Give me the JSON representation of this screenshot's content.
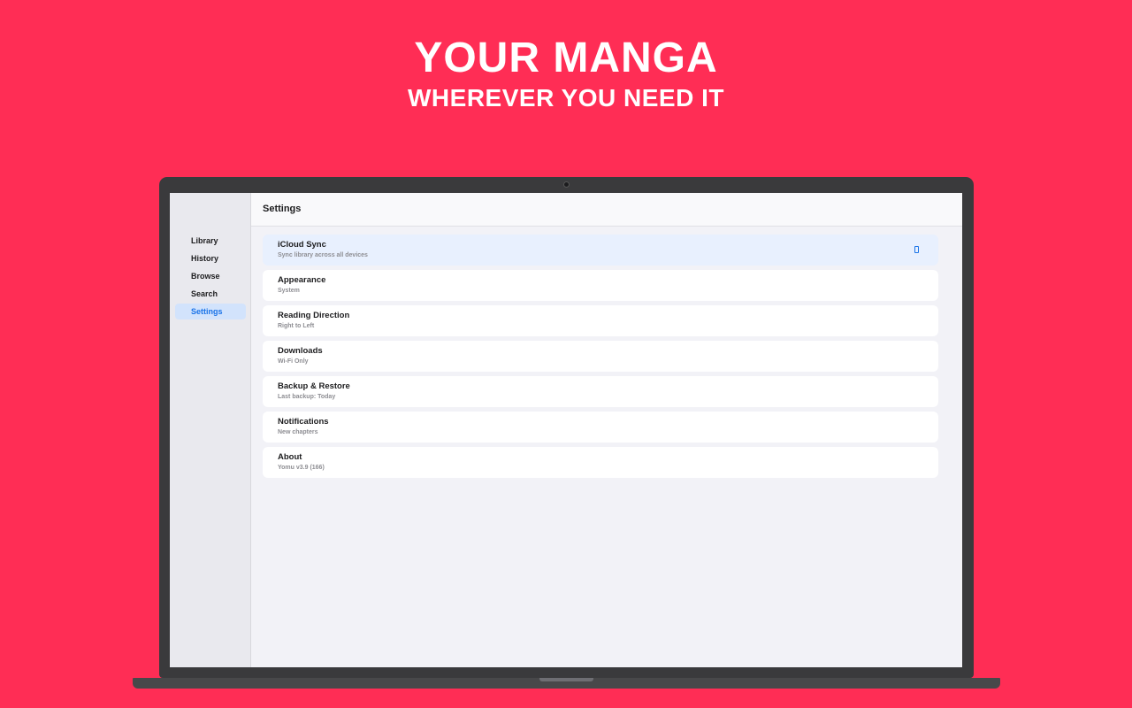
{
  "hero": {
    "headline": "YOUR MANGA",
    "subline": "WHEREVER YOU NEED IT"
  },
  "colors": {
    "background": "#ff2d55",
    "accent": "#1a73e8",
    "highlight": "#e8f0fe"
  },
  "sidebar": {
    "items": [
      {
        "label": "Library"
      },
      {
        "label": "History"
      },
      {
        "label": "Browse"
      },
      {
        "label": "Search"
      },
      {
        "label": "Settings",
        "active": true
      }
    ]
  },
  "main": {
    "title": "Settings",
    "settings": [
      {
        "title": "iCloud Sync",
        "subtitle": "Sync library across all devices",
        "icon": "toggle-icon"
      },
      {
        "title": "Appearance",
        "subtitle": "System"
      },
      {
        "title": "Reading Direction",
        "subtitle": "Right to Left"
      },
      {
        "title": "Downloads",
        "subtitle": "Wi-Fi Only"
      },
      {
        "title": "Backup & Restore",
        "subtitle": "Last backup: Today"
      },
      {
        "title": "Notifications",
        "subtitle": "New chapters"
      },
      {
        "title": "About",
        "subtitle": "Yomu v3.9 (166)"
      }
    ]
  }
}
